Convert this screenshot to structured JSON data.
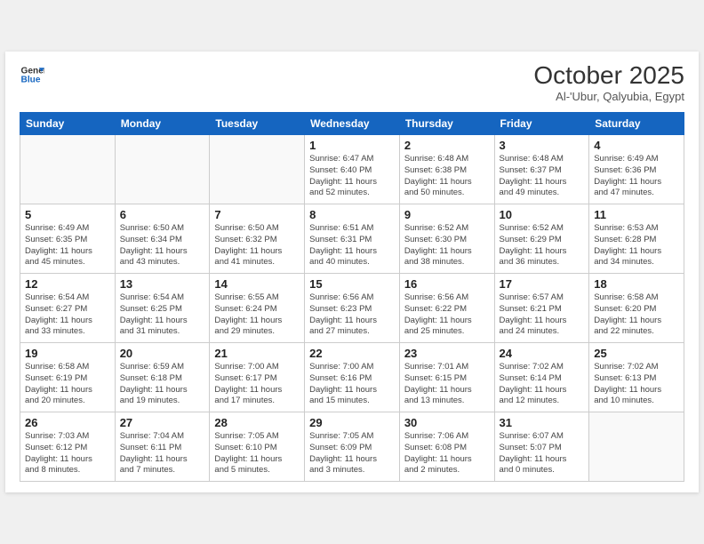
{
  "header": {
    "logo_line1": "General",
    "logo_line2": "Blue",
    "month": "October 2025",
    "location": "Al-'Ubur, Qalyubia, Egypt"
  },
  "days": [
    "Sunday",
    "Monday",
    "Tuesday",
    "Wednesday",
    "Thursday",
    "Friday",
    "Saturday"
  ],
  "weeks": [
    [
      {
        "date": "",
        "info": ""
      },
      {
        "date": "",
        "info": ""
      },
      {
        "date": "",
        "info": ""
      },
      {
        "date": "1",
        "info": "Sunrise: 6:47 AM\nSunset: 6:40 PM\nDaylight: 11 hours\nand 52 minutes."
      },
      {
        "date": "2",
        "info": "Sunrise: 6:48 AM\nSunset: 6:38 PM\nDaylight: 11 hours\nand 50 minutes."
      },
      {
        "date": "3",
        "info": "Sunrise: 6:48 AM\nSunset: 6:37 PM\nDaylight: 11 hours\nand 49 minutes."
      },
      {
        "date": "4",
        "info": "Sunrise: 6:49 AM\nSunset: 6:36 PM\nDaylight: 11 hours\nand 47 minutes."
      }
    ],
    [
      {
        "date": "5",
        "info": "Sunrise: 6:49 AM\nSunset: 6:35 PM\nDaylight: 11 hours\nand 45 minutes."
      },
      {
        "date": "6",
        "info": "Sunrise: 6:50 AM\nSunset: 6:34 PM\nDaylight: 11 hours\nand 43 minutes."
      },
      {
        "date": "7",
        "info": "Sunrise: 6:50 AM\nSunset: 6:32 PM\nDaylight: 11 hours\nand 41 minutes."
      },
      {
        "date": "8",
        "info": "Sunrise: 6:51 AM\nSunset: 6:31 PM\nDaylight: 11 hours\nand 40 minutes."
      },
      {
        "date": "9",
        "info": "Sunrise: 6:52 AM\nSunset: 6:30 PM\nDaylight: 11 hours\nand 38 minutes."
      },
      {
        "date": "10",
        "info": "Sunrise: 6:52 AM\nSunset: 6:29 PM\nDaylight: 11 hours\nand 36 minutes."
      },
      {
        "date": "11",
        "info": "Sunrise: 6:53 AM\nSunset: 6:28 PM\nDaylight: 11 hours\nand 34 minutes."
      }
    ],
    [
      {
        "date": "12",
        "info": "Sunrise: 6:54 AM\nSunset: 6:27 PM\nDaylight: 11 hours\nand 33 minutes."
      },
      {
        "date": "13",
        "info": "Sunrise: 6:54 AM\nSunset: 6:25 PM\nDaylight: 11 hours\nand 31 minutes."
      },
      {
        "date": "14",
        "info": "Sunrise: 6:55 AM\nSunset: 6:24 PM\nDaylight: 11 hours\nand 29 minutes."
      },
      {
        "date": "15",
        "info": "Sunrise: 6:56 AM\nSunset: 6:23 PM\nDaylight: 11 hours\nand 27 minutes."
      },
      {
        "date": "16",
        "info": "Sunrise: 6:56 AM\nSunset: 6:22 PM\nDaylight: 11 hours\nand 25 minutes."
      },
      {
        "date": "17",
        "info": "Sunrise: 6:57 AM\nSunset: 6:21 PM\nDaylight: 11 hours\nand 24 minutes."
      },
      {
        "date": "18",
        "info": "Sunrise: 6:58 AM\nSunset: 6:20 PM\nDaylight: 11 hours\nand 22 minutes."
      }
    ],
    [
      {
        "date": "19",
        "info": "Sunrise: 6:58 AM\nSunset: 6:19 PM\nDaylight: 11 hours\nand 20 minutes."
      },
      {
        "date": "20",
        "info": "Sunrise: 6:59 AM\nSunset: 6:18 PM\nDaylight: 11 hours\nand 19 minutes."
      },
      {
        "date": "21",
        "info": "Sunrise: 7:00 AM\nSunset: 6:17 PM\nDaylight: 11 hours\nand 17 minutes."
      },
      {
        "date": "22",
        "info": "Sunrise: 7:00 AM\nSunset: 6:16 PM\nDaylight: 11 hours\nand 15 minutes."
      },
      {
        "date": "23",
        "info": "Sunrise: 7:01 AM\nSunset: 6:15 PM\nDaylight: 11 hours\nand 13 minutes."
      },
      {
        "date": "24",
        "info": "Sunrise: 7:02 AM\nSunset: 6:14 PM\nDaylight: 11 hours\nand 12 minutes."
      },
      {
        "date": "25",
        "info": "Sunrise: 7:02 AM\nSunset: 6:13 PM\nDaylight: 11 hours\nand 10 minutes."
      }
    ],
    [
      {
        "date": "26",
        "info": "Sunrise: 7:03 AM\nSunset: 6:12 PM\nDaylight: 11 hours\nand 8 minutes."
      },
      {
        "date": "27",
        "info": "Sunrise: 7:04 AM\nSunset: 6:11 PM\nDaylight: 11 hours\nand 7 minutes."
      },
      {
        "date": "28",
        "info": "Sunrise: 7:05 AM\nSunset: 6:10 PM\nDaylight: 11 hours\nand 5 minutes."
      },
      {
        "date": "29",
        "info": "Sunrise: 7:05 AM\nSunset: 6:09 PM\nDaylight: 11 hours\nand 3 minutes."
      },
      {
        "date": "30",
        "info": "Sunrise: 7:06 AM\nSunset: 6:08 PM\nDaylight: 11 hours\nand 2 minutes."
      },
      {
        "date": "31",
        "info": "Sunrise: 6:07 AM\nSunset: 5:07 PM\nDaylight: 11 hours\nand 0 minutes."
      },
      {
        "date": "",
        "info": ""
      }
    ]
  ]
}
